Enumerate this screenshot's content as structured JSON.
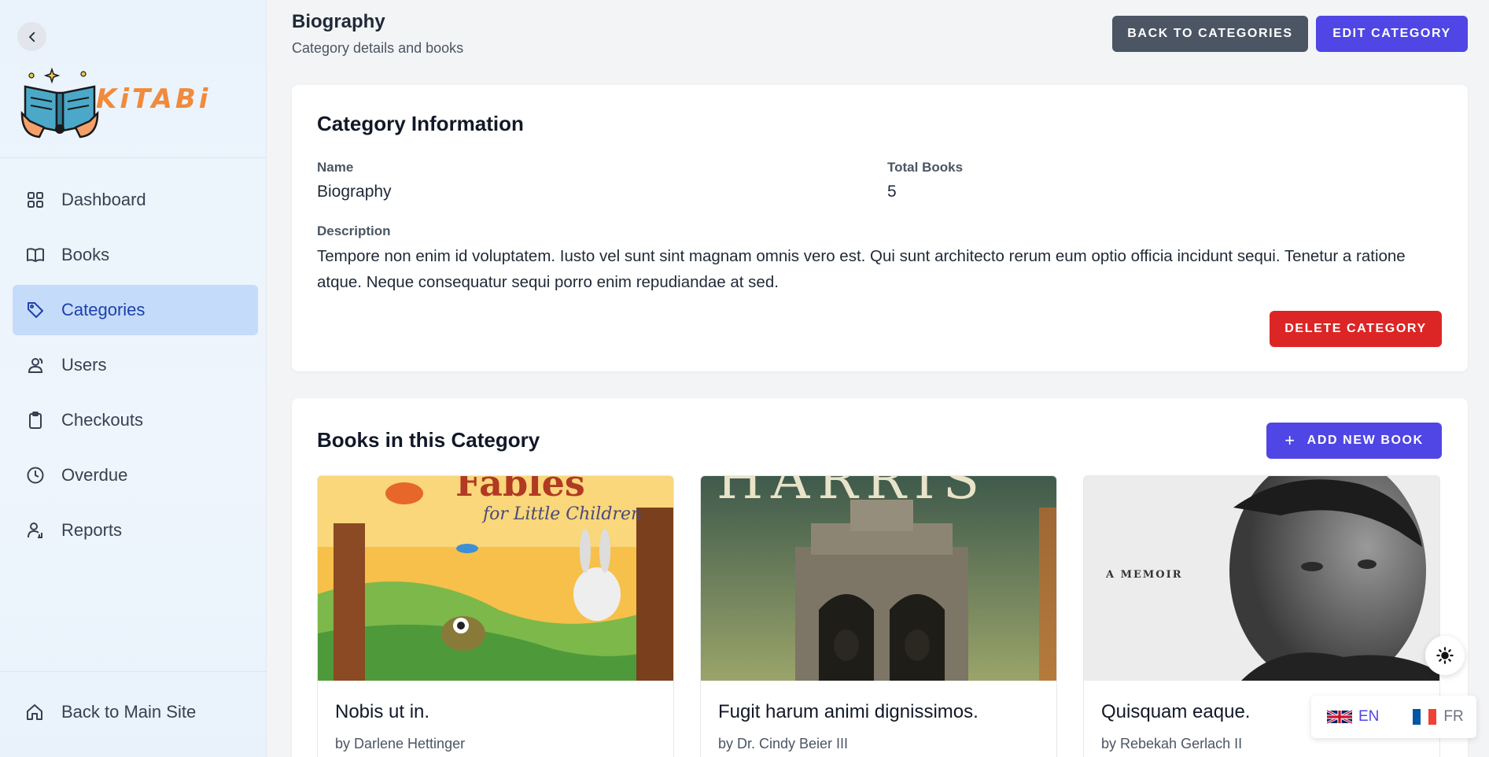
{
  "brand": {
    "name": "KiTABi"
  },
  "sidebar": {
    "items": [
      {
        "label": "Dashboard",
        "icon": "grid-icon"
      },
      {
        "label": "Books",
        "icon": "book-open-icon"
      },
      {
        "label": "Categories",
        "icon": "tag-icon",
        "active": true
      },
      {
        "label": "Users",
        "icon": "users-icon"
      },
      {
        "label": "Checkouts",
        "icon": "clipboard-icon"
      },
      {
        "label": "Overdue",
        "icon": "clock-icon"
      },
      {
        "label": "Reports",
        "icon": "user-chart-icon"
      }
    ],
    "back_main": "Back to Main Site"
  },
  "header": {
    "title": "Biography",
    "subtitle": "Category details and books",
    "back_label": "BACK TO CATEGORIES",
    "edit_label": "EDIT CATEGORY"
  },
  "info": {
    "title": "Category Information",
    "name_label": "Name",
    "name_value": "Biography",
    "total_label": "Total Books",
    "total_value": "5",
    "desc_label": "Description",
    "desc_value": "Tempore non enim id voluptatem. Iusto vel sunt sint magnam omnis vero est. Qui sunt architecto rerum eum optio officia incidunt sequi. Tenetur a ratione atque. Neque consequatur sequi porro enim repudiandae at sed.",
    "delete_label": "DELETE CATEGORY"
  },
  "books_section": {
    "title": "Books in this Category",
    "add_label": "ADD NEW BOOK",
    "books": [
      {
        "title": "Nobis ut in.",
        "author": "by Darlene Hettinger",
        "cover_text": "Fables",
        "cover_sub": "for Little Children"
      },
      {
        "title": "Fugit harum animi dignissimos.",
        "author": "by Dr. Cindy Beier III",
        "cover_text": "HARRIS"
      },
      {
        "title": "Quisquam eaque.",
        "author": "by Rebekah Gerlach II",
        "cover_text": "A MEMOIR"
      }
    ]
  },
  "languages": [
    {
      "code": "EN",
      "active": true
    },
    {
      "code": "FR",
      "active": false
    }
  ],
  "colors": {
    "primary": "#4f46e5",
    "danger": "#dc2626",
    "secondary": "#4b5563",
    "active_nav": "#c4dcf9"
  }
}
